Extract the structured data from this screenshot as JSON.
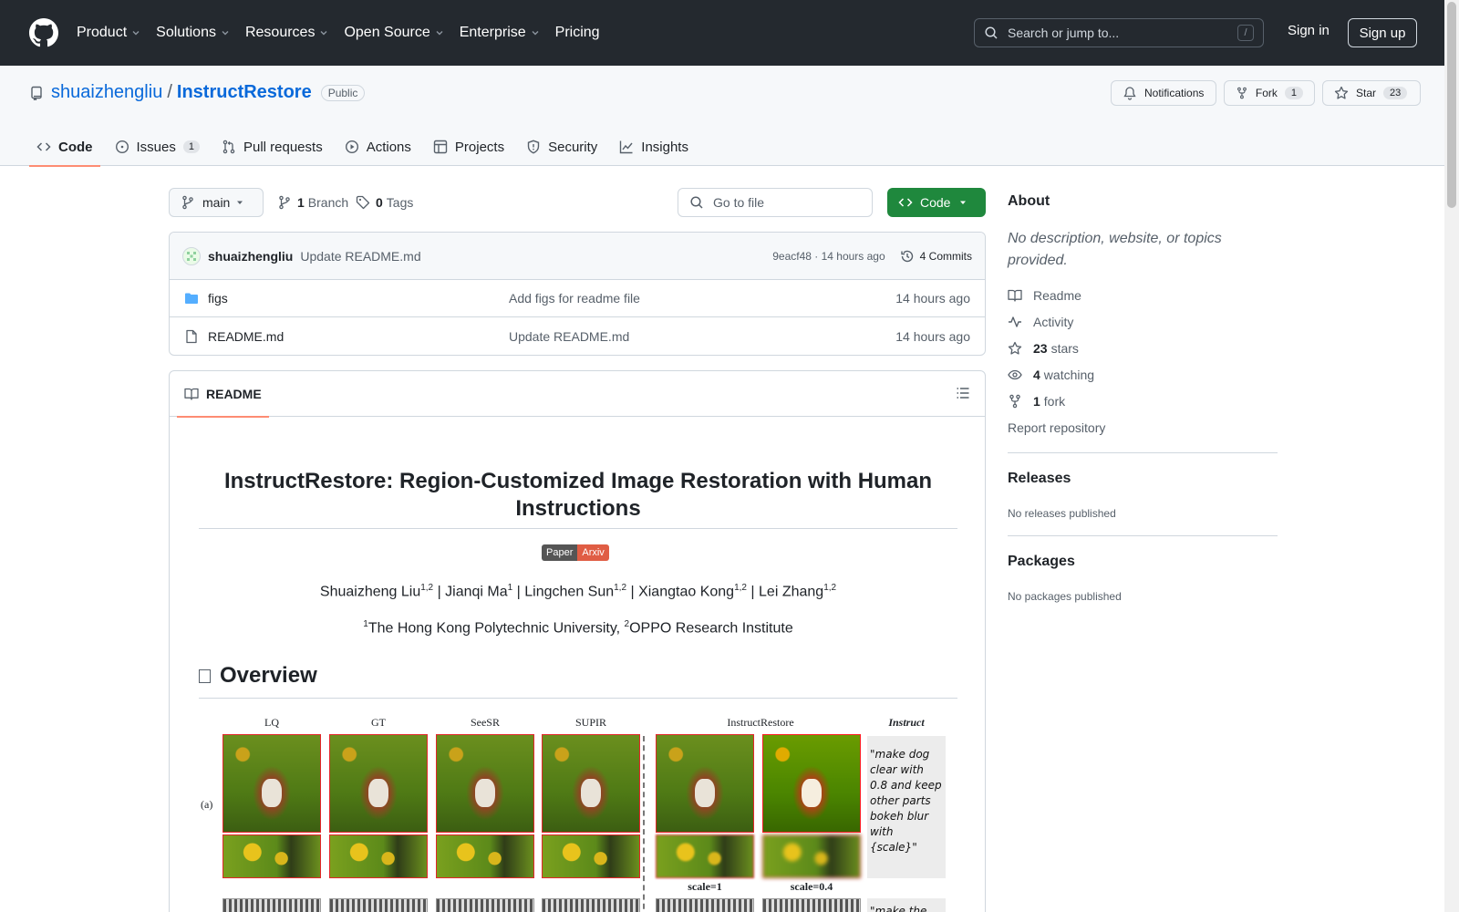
{
  "header": {
    "nav": [
      "Product",
      "Solutions",
      "Resources",
      "Open Source",
      "Enterprise",
      "Pricing"
    ],
    "search_placeholder": "Search or jump to...",
    "search_shortcut": "/",
    "sign_in": "Sign in",
    "sign_up": "Sign up"
  },
  "repo": {
    "owner": "shuaizhengliu",
    "separator": "/",
    "name": "InstructRestore",
    "visibility": "Public",
    "notifications_label": "Notifications",
    "fork_label": "Fork",
    "fork_count": "1",
    "star_label": "Star",
    "star_count": "23"
  },
  "tabs": [
    {
      "label": "Code",
      "count": ""
    },
    {
      "label": "Issues",
      "count": "1"
    },
    {
      "label": "Pull requests",
      "count": ""
    },
    {
      "label": "Actions",
      "count": ""
    },
    {
      "label": "Projects",
      "count": ""
    },
    {
      "label": "Security",
      "count": ""
    },
    {
      "label": "Insights",
      "count": ""
    }
  ],
  "toolbar": {
    "branch": "main",
    "branch_count": "1",
    "branch_label": "Branch",
    "tag_count": "0",
    "tag_label": "Tags",
    "go_to_file": "Go to file",
    "code_button": "Code"
  },
  "latest_commit": {
    "author": "shuaizhengliu",
    "message": "Update README.md",
    "hash_time": "9eacf48 · 14 hours ago",
    "commits": "4 Commits"
  },
  "files": [
    {
      "name": "figs",
      "type": "folder",
      "message": "Add figs for readme file",
      "time": "14 hours ago"
    },
    {
      "name": "README.md",
      "type": "file",
      "message": "Update README.md",
      "time": "14 hours ago"
    }
  ],
  "readme": {
    "tab": "README",
    "title": "InstructRestore: Region-Customized Image Restoration with Human Instructions",
    "badge_left": "Paper",
    "badge_right": "Arxiv",
    "authors": [
      {
        "name": "Shuaizheng Liu",
        "sup": "1,2"
      },
      {
        "name": "Jianqi Ma",
        "sup": "1"
      },
      {
        "name": "Lingchen Sun",
        "sup": "1,2"
      },
      {
        "name": "Xiangtao Kong",
        "sup": "1,2"
      },
      {
        "name": "Lei Zhang",
        "sup": "1,2"
      }
    ],
    "author_sep": " | ",
    "affil1_sup": "1",
    "affil1": "The Hong Kong Polytechnic University, ",
    "affil2_sup": "2",
    "affil2": "OPPO Research Institute",
    "overview": "Overview",
    "figure": {
      "captions": [
        "LQ",
        "GT",
        "SeeSR",
        "SUPIR",
        "InstructRestore",
        "Instruct"
      ],
      "row_label": "(a)",
      "instruct_text": "\"make dog clear with 0.8 and keep other parts bokeh blur with {scale}\"",
      "instruct_text2": "\"make the",
      "scale1": "scale=1",
      "scale2": "scale=0.4"
    }
  },
  "sidebar": {
    "about": "About",
    "description": "No description, website, or topics provided.",
    "readme": "Readme",
    "activity": "Activity",
    "stars_count": "23",
    "stars_label": "stars",
    "watching_count": "4",
    "watching_label": "watching",
    "fork_count": "1",
    "fork_label": "fork",
    "report": "Report repository",
    "releases": "Releases",
    "no_releases": "No releases published",
    "packages": "Packages",
    "no_packages": "No packages published"
  }
}
